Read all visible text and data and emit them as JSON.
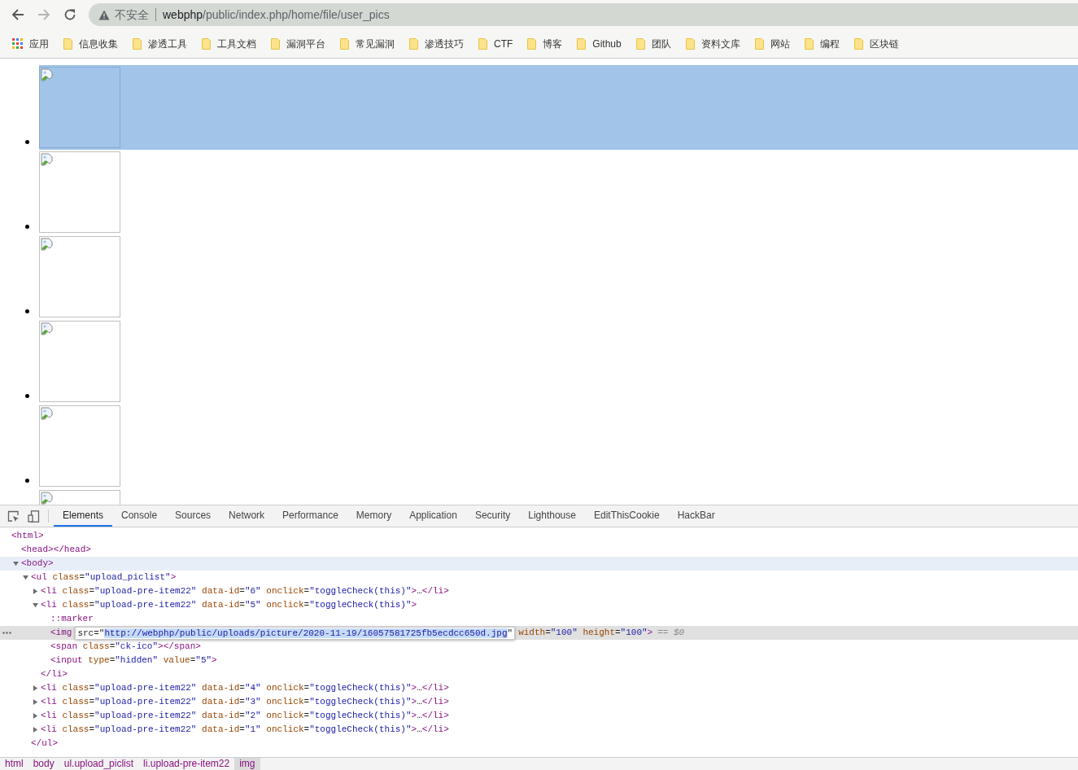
{
  "browser": {
    "address": {
      "security_label": "不安全",
      "host": "webphp",
      "path": "/public/index.php/home/file/user_pics"
    }
  },
  "bookmarks": [
    {
      "kind": "apps",
      "label": "应用"
    },
    {
      "kind": "folder",
      "label": "信息收集"
    },
    {
      "kind": "folder",
      "label": "渗透工具"
    },
    {
      "kind": "folder",
      "label": "工具文档"
    },
    {
      "kind": "folder",
      "label": "漏洞平台"
    },
    {
      "kind": "folder",
      "label": "常见漏洞"
    },
    {
      "kind": "folder",
      "label": "渗透技巧"
    },
    {
      "kind": "folder",
      "label": "CTF"
    },
    {
      "kind": "folder",
      "label": "博客"
    },
    {
      "kind": "folder",
      "label": "Github"
    },
    {
      "kind": "folder",
      "label": "团队"
    },
    {
      "kind": "folder",
      "label": "资料文库"
    },
    {
      "kind": "folder",
      "label": "网站"
    },
    {
      "kind": "folder",
      "label": "编程"
    },
    {
      "kind": "folder",
      "label": "区块链"
    }
  ],
  "page": {
    "items": [
      {
        "highlighted": true
      },
      {
        "highlighted": false
      },
      {
        "highlighted": false
      },
      {
        "highlighted": false
      },
      {
        "highlighted": false
      },
      {
        "highlighted": false
      }
    ]
  },
  "devtools": {
    "tabs": [
      {
        "label": "Elements",
        "selected": true
      },
      {
        "label": "Console",
        "selected": false
      },
      {
        "label": "Sources",
        "selected": false
      },
      {
        "label": "Network",
        "selected": false
      },
      {
        "label": "Performance",
        "selected": false
      },
      {
        "label": "Memory",
        "selected": false
      },
      {
        "label": "Application",
        "selected": false
      },
      {
        "label": "Security",
        "selected": false
      },
      {
        "label": "Lighthouse",
        "selected": false
      },
      {
        "label": "EditThisCookie",
        "selected": false
      },
      {
        "label": "HackBar",
        "selected": false
      }
    ],
    "tree": [
      {
        "kind": "element",
        "line": "<html>",
        "selected": false,
        "hovered": false,
        "children": [
          {
            "kind": "element",
            "line": "<head></head>",
            "selected": false,
            "hovered": false
          },
          {
            "kind": "element",
            "line": "<body>",
            "expanded": true,
            "selected": false,
            "hovered": true,
            "children": [
              {
                "kind": "element",
                "line": "<ul class=\"upload_piclist\">",
                "expanded": true,
                "selected": false,
                "hovered": false,
                "close": "</ul>",
                "children": [
                  {
                    "kind": "element",
                    "line": "<li class=\"upload-pre-item22\" data-id=\"6\" onclick=\"toggleCheck(this)\">…</li>",
                    "expanded": false,
                    "selected": false,
                    "hovered": false
                  },
                  {
                    "kind": "element",
                    "line": "<li class=\"upload-pre-item22\" data-id=\"5\" onclick=\"toggleCheck(this)\">",
                    "expanded": true,
                    "selected": false,
                    "hovered": false,
                    "close": "</li>",
                    "children": [
                      {
                        "kind": "pseudo",
                        "line": "::marker",
                        "selected": false,
                        "hovered": false
                      },
                      {
                        "kind": "editing",
                        "line": "<img",
                        "edit_prefix": "src=\"",
                        "edit_value": "http://webphp/public/uploads/picture/2020-11-19/16057581725fb5ecdcc650d.jpg",
                        "edit_suffix": "\"",
                        "rest": "width=\"100\" height=\"100\">",
                        "console_ref": "== $0",
                        "selected": true,
                        "hovered": false
                      },
                      {
                        "kind": "element",
                        "line": "<span class=\"ck-ico\"></span>",
                        "selected": false,
                        "hovered": false
                      },
                      {
                        "kind": "element",
                        "line": "<input type=\"hidden\" value=\"5\">",
                        "selected": false,
                        "hovered": false
                      }
                    ]
                  },
                  {
                    "kind": "element",
                    "line": "<li class=\"upload-pre-item22\" data-id=\"4\" onclick=\"toggleCheck(this)\">…</li>",
                    "expanded": false,
                    "selected": false,
                    "hovered": false
                  },
                  {
                    "kind": "element",
                    "line": "<li class=\"upload-pre-item22\" data-id=\"3\" onclick=\"toggleCheck(this)\">…</li>",
                    "expanded": false,
                    "selected": false,
                    "hovered": false
                  },
                  {
                    "kind": "element",
                    "line": "<li class=\"upload-pre-item22\" data-id=\"2\" onclick=\"toggleCheck(this)\">…</li>",
                    "expanded": false,
                    "selected": false,
                    "hovered": false
                  },
                  {
                    "kind": "element",
                    "line": "<li class=\"upload-pre-item22\" data-id=\"1\" onclick=\"toggleCheck(this)\">…</li>",
                    "expanded": false,
                    "selected": false,
                    "hovered": false
                  }
                ]
              }
            ]
          }
        ]
      }
    ],
    "breadcrumbs": [
      {
        "label": "html",
        "selected": false
      },
      {
        "label": "body",
        "selected": false
      },
      {
        "label": "ul.upload_piclist",
        "selected": false
      },
      {
        "label": "li.upload-pre-item22",
        "selected": false
      },
      {
        "label": "img",
        "selected": true
      }
    ]
  }
}
